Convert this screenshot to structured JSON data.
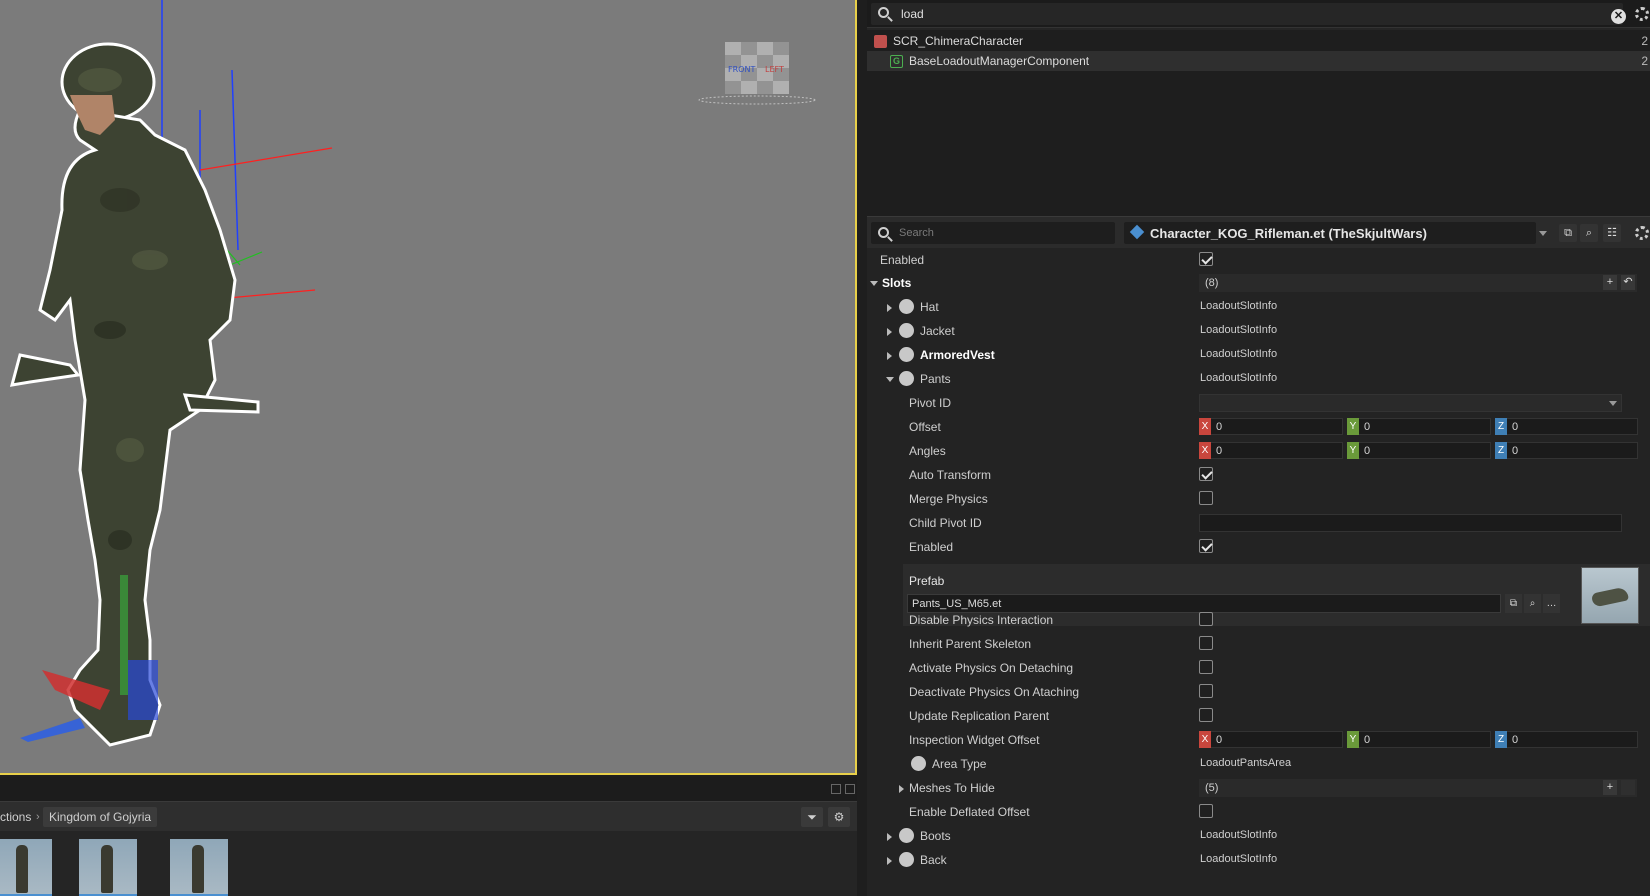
{
  "viewport": {
    "gizmo_labels": [
      "FRONT",
      "LEFT"
    ]
  },
  "browser": {
    "breadcrumb": [
      "ctions",
      "Kingdom of Gojyria"
    ],
    "icons": [
      "filter-icon",
      "gear-icon"
    ]
  },
  "component_search": {
    "value": "load"
  },
  "components": [
    {
      "name": "SCR_ChimeraCharacter",
      "icon": "entity-cube-icon",
      "color": "#c0504d",
      "count": "2"
    },
    {
      "name": "BaseLoadoutManagerComponent",
      "icon": "component-g-icon",
      "color": "#4caf50",
      "count": "2"
    }
  ],
  "props_bar": {
    "search_placeholder": "Search",
    "prefab": "Character_KOG_Rifleman.et (TheSkjultWars)"
  },
  "props": {
    "enabled": "Enabled",
    "slots": "Slots",
    "slots_count": "(8)",
    "hat": "Hat",
    "jacket": "Jacket",
    "armored_vest": "ArmoredVest",
    "pants": "Pants",
    "slot_info": "LoadoutSlotInfo",
    "pivot_id": "Pivot ID",
    "offset": "Offset",
    "angles": "Angles",
    "auto_transform": "Auto Transform",
    "merge_physics": "Merge Physics",
    "child_pivot_id": "Child Pivot ID",
    "enabled2": "Enabled",
    "prefab_label": "Prefab",
    "prefab_value": "Pants_US_M65.et",
    "disable_phys": "Disable Physics Interaction",
    "inherit_skel": "Inherit Parent Skeleton",
    "activate_phys": "Activate Physics On Detaching",
    "deactivate_phys": "Deactivate Physics On Ataching",
    "update_repl": "Update Replication Parent",
    "insp_offset": "Inspection Widget Offset",
    "area_type": "Area Type",
    "area_value": "LoadoutPantsArea",
    "meshes_hide": "Meshes To Hide",
    "meshes_count": "(5)",
    "enable_deflated": "Enable Deflated Offset",
    "boots": "Boots",
    "back": "Back",
    "vec_x": "X",
    "vec_y": "Y",
    "vec_z": "Z",
    "zero": "0",
    "plus": "+"
  },
  "colors": {
    "axis_x": "#c9463d",
    "axis_y": "#6a9a3a",
    "axis_z": "#3f7fb5",
    "viewport_border": "#e8d04a"
  }
}
